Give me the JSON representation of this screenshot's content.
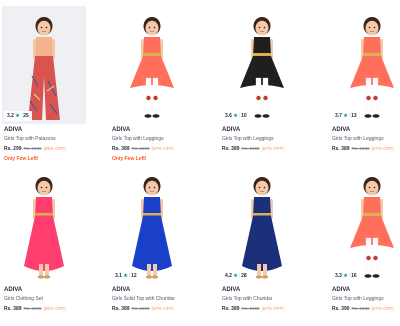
{
  "products": [
    {
      "brand": "ADIVA",
      "name": "Girls Top with Palazzos",
      "price": "Rs. 299",
      "mrp": "Rs. 1999",
      "off": "(85% OFF)",
      "rating": "3.2",
      "count": "25",
      "few": "Only Few Left!",
      "dress": "#f2b38e",
      "skirt": "#d9534f",
      "bg": "gray",
      "style": "palazzo"
    },
    {
      "brand": "ADIVA",
      "name": "Girls Top with Leggings",
      "price": "Rs. 389",
      "mrp": "Rs. 1599",
      "off": "(67% OFF)",
      "rating": "",
      "count": "",
      "few": "Only Few Left!",
      "dress": "#ff6f5c",
      "skirt": "#ff6f5c",
      "bg": "white",
      "style": "hilo"
    },
    {
      "brand": "ADIVA",
      "name": "Girls Top with Leggings",
      "price": "Rs. 389",
      "mrp": "Rs. 1599",
      "off": "(67% OFF)",
      "rating": "3.6",
      "count": "10",
      "few": "",
      "dress": "#1f1f1f",
      "skirt": "#1f1f1f",
      "bg": "white",
      "style": "hilo"
    },
    {
      "brand": "ADIVA",
      "name": "Girls Top with Leggings",
      "price": "Rs. 389",
      "mrp": "Rs. 1599",
      "off": "(67% OFF)",
      "rating": "3.7",
      "count": "13",
      "few": "",
      "dress": "#ff6f5c",
      "skirt": "#ff6f5c",
      "bg": "white",
      "style": "hilo"
    },
    {
      "brand": "ADIVA",
      "name": "Girls Clothing Set",
      "price": "Rs. 389",
      "mrp": "Rs. 1899",
      "off": "(80% OFF)",
      "rating": "",
      "count": "",
      "few": "",
      "dress": "#ff3d6e",
      "skirt": "#ff3d6e",
      "bg": "white",
      "style": "gown"
    },
    {
      "brand": "ADIVA",
      "name": "Girls Solid Top with Churidar",
      "price": "Rs. 389",
      "mrp": "Rs. 1599",
      "off": "(67% OFF)",
      "rating": "3.1",
      "count": "12",
      "few": "",
      "dress": "#1a3fc8",
      "skirt": "#1a3fc8",
      "bg": "white",
      "style": "gown"
    },
    {
      "brand": "ADIVA",
      "name": "Girls Top with Churidar",
      "price": "Rs. 389",
      "mrp": "Rs. 1599",
      "off": "(67% OFF)",
      "rating": "4.2",
      "count": "28",
      "few": "",
      "dress": "#1c2f7a",
      "skirt": "#1c2f7a",
      "bg": "white",
      "style": "gown"
    },
    {
      "brand": "ADIVA",
      "name": "Girls Top with Leggings",
      "price": "Rs. 390",
      "mrp": "Rs. 1599",
      "off": "(67% OFF)",
      "rating": "3.3",
      "count": "16",
      "few": "",
      "dress": "#ff6f5c",
      "skirt": "#ff6f5c",
      "bg": "white",
      "style": "hilo"
    }
  ],
  "icons": {
    "rating_star": "star-icon"
  }
}
